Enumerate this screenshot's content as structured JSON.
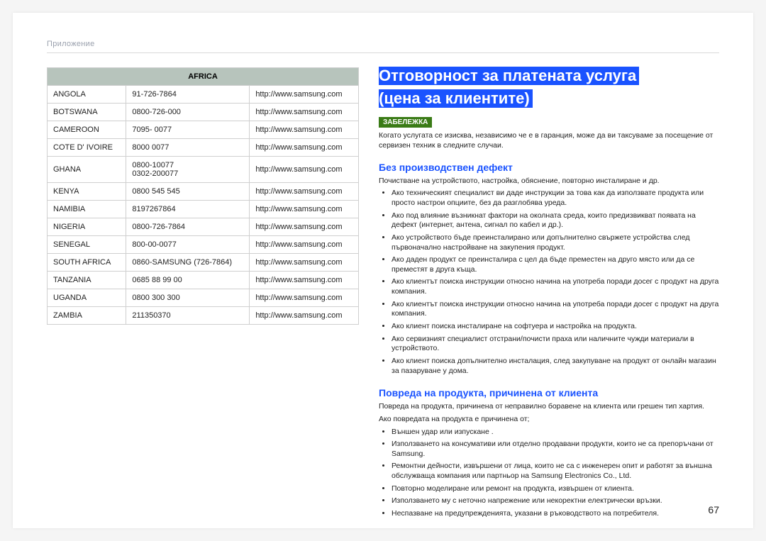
{
  "header": {
    "label": "Приложение"
  },
  "table": {
    "title": "AFRICA",
    "rows": [
      {
        "country": "ANGOLA",
        "phone": "91-726-7864",
        "url": "http://www.samsung.com"
      },
      {
        "country": "BOTSWANA",
        "phone": "0800-726-000",
        "url": "http://www.samsung.com"
      },
      {
        "country": "CAMEROON",
        "phone": "7095- 0077",
        "url": "http://www.samsung.com"
      },
      {
        "country": "COTE D' IVOIRE",
        "phone": "8000 0077",
        "url": "http://www.samsung.com"
      },
      {
        "country": "GHANA",
        "phone": "0800-10077\n0302-200077",
        "url": "http://www.samsung.com"
      },
      {
        "country": "KENYA",
        "phone": "0800 545 545",
        "url": "http://www.samsung.com"
      },
      {
        "country": "NAMIBIA",
        "phone": "8197267864",
        "url": "http://www.samsung.com"
      },
      {
        "country": "NIGERIA",
        "phone": "0800-726-7864",
        "url": "http://www.samsung.com"
      },
      {
        "country": "SENEGAL",
        "phone": "800-00-0077",
        "url": "http://www.samsung.com"
      },
      {
        "country": "SOUTH AFRICA",
        "phone": "0860-SAMSUNG (726-7864)",
        "url": "http://www.samsung.com"
      },
      {
        "country": "TANZANIA",
        "phone": "0685 88 99 00",
        "url": "http://www.samsung.com"
      },
      {
        "country": "UGANDA",
        "phone": "0800 300 300",
        "url": "http://www.samsung.com"
      },
      {
        "country": "ZAMBIA",
        "phone": "211350370",
        "url": "http://www.samsung.com"
      }
    ]
  },
  "main": {
    "title_line1": "Отговорност за платената услуга",
    "title_line2": "(цена за клиентите)",
    "note_badge": "ЗАБЕЛЕЖКА",
    "note_body": "Когато услугата се изисква, независимо че е в гаранция, може да ви таксуваме за посещение от сервизен техник в следните случаи.",
    "section1": {
      "heading": "Без производствен дефект",
      "intro": "Почистване на устройството, настройка, обяснение, повторно инсталиране и др.",
      "bullets": [
        "Ако техническият специалист ви даде инструкции за това как да използвате продукта или просто настрои опциите, без да разглобява уреда.",
        "Ако под влияние възникнат фактори на околната среда, които предизвикват появата на дефект (интернет, антена, сигнал по кабел и др.).",
        "Ако устройството бъде преинсталирано или допълнително свържете устройства след първоначално настройване на закупения продукт.",
        "Ако даден продукт се преинсталира с цел да бъде преместен на друго място или да се преместят в друга къща.",
        "Ако клиентът поиска инструкции относно начина на употреба поради досег с продукт на друга компания.",
        "Ако клиентът поиска инструкции относно начина на употреба поради досег с продукт на друга компания.",
        "Ако клиент поиска инсталиране на софтуера и настройка на продукта.",
        "Ако сервизният специалист отстрани/почисти праха или наличните чужди материали в устройството.",
        "Ако клиент поиска допълнително инсталация, след закупуване на продукт от онлайн магазин за пазаруване у дома."
      ]
    },
    "section2": {
      "heading": "Повреда на продукта, причинена от клиента",
      "line1": "Повреда на продукта, причинена от неправилно боравене на клиента или грешен тип хартия.",
      "line2": "Ако повредата на продукта е причинена от;",
      "bullets": [
        "Външен удар или изпускане .",
        "Използването на консумативи или отделно продавани продукти, които не са препоръчани от Samsung.",
        "Ремонтни дейности, извършени от лица, които не са с инженерен опит и работят за външна обслужваща компания или партньор на Samsung Electronics Co., Ltd.",
        "Повторно моделиране или ремонт на продукта, извършен от клиента.",
        "Използването му с неточно напрежение или некоректни електрически връзки.",
        "Неспазване на предупрежденията, указани в ръководството на потребителя."
      ]
    }
  },
  "page_number": "67"
}
